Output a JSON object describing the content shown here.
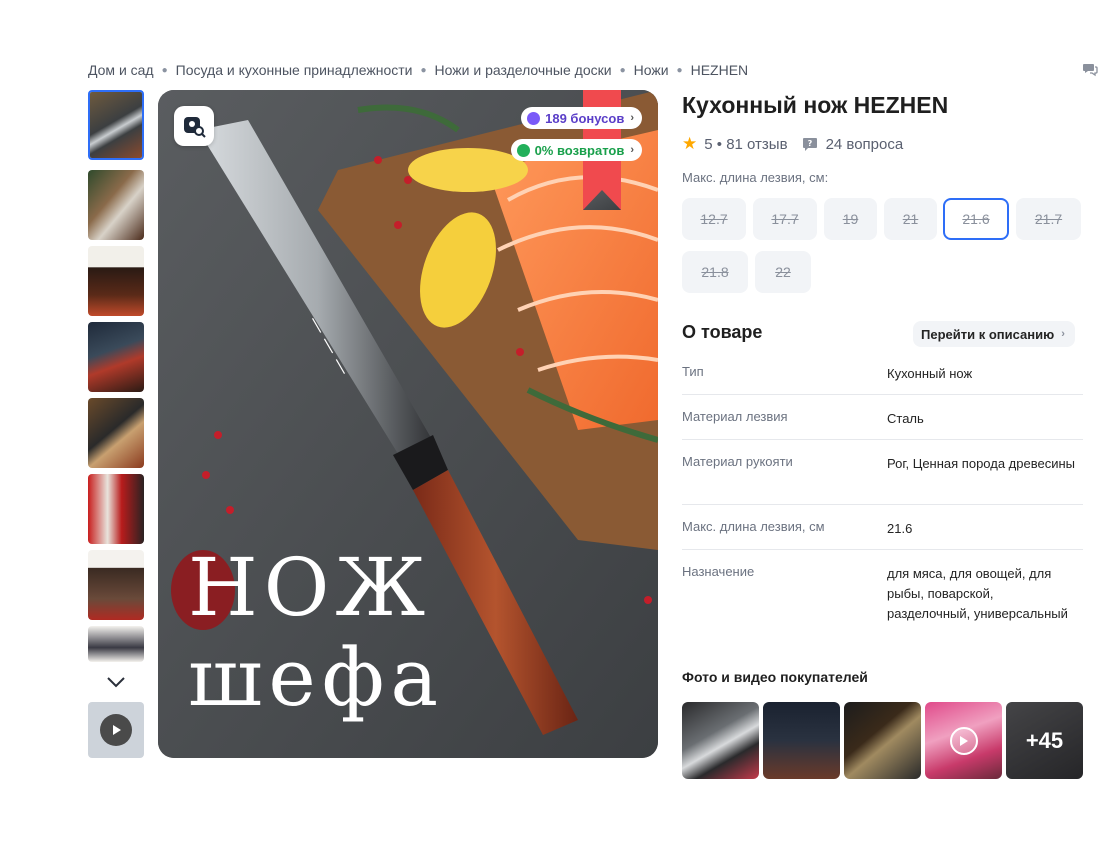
{
  "breadcrumb": [
    "Дом и сад",
    "Посуда и кухонные принадлежности",
    "Ножи и разделочные доски",
    "Ножи",
    "HEZHEN"
  ],
  "product": {
    "title": "Кухонный нож HEZHEN",
    "rating": "5",
    "reviews": "81 отзыв",
    "questions": "24 вопроса"
  },
  "main_image": {
    "headline_line1": "НОЖ",
    "headline_line2": "шефа",
    "badge_bonus": "189 бонусов",
    "badge_returns": "0% возвратов"
  },
  "options": {
    "label": "Макс. длина лезвия, см:",
    "values": [
      "12.7",
      "17.7",
      "19",
      "21",
      "21.6",
      "21.7",
      "21.8",
      "22"
    ],
    "selected": "21.6"
  },
  "about": {
    "title": "О товаре",
    "go_to_description": "Перейти к описанию",
    "specs": [
      {
        "key": "Тип",
        "value": "Кухонный нож"
      },
      {
        "key": "Материал лезвия",
        "value": "Сталь"
      },
      {
        "key": "Материал рукояти",
        "value": "Рог, Ценная порода древесины"
      },
      {
        "key": "Макс. длина лезвия, см",
        "value": "21.6"
      },
      {
        "key": "Назначение",
        "value": "для мяса, для овощей, для рыбы, поварской, разделочный, универсальный"
      }
    ]
  },
  "customer_photos": {
    "title": "Фото и видео покупателей",
    "more_count": "+45"
  },
  "colors": {
    "accent": "#2e6ef7",
    "star": "#ffa800",
    "bonus": "#5a3ec8",
    "returns": "#19a04b"
  }
}
